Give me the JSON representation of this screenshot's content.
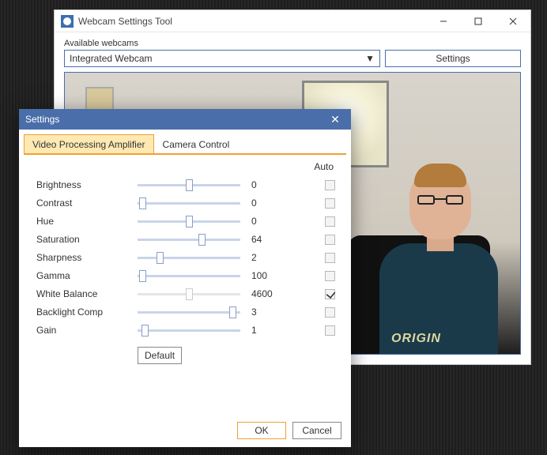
{
  "main": {
    "title": "Webcam Settings Tool",
    "group_label": "Available webcams",
    "combo_value": "Integrated Webcam",
    "settings_btn": "Settings"
  },
  "dialog": {
    "title": "Settings",
    "tabs": {
      "vpa": "Video Processing Amplifier",
      "cc": "Camera Control"
    },
    "auto_header": "Auto",
    "default_btn": "Default",
    "ok": "OK",
    "cancel": "Cancel",
    "rows": [
      {
        "label": "Brightness",
        "value": "0",
        "pos": 50,
        "auto": false,
        "enabled": true
      },
      {
        "label": "Contrast",
        "value": "0",
        "pos": 2,
        "auto": false,
        "enabled": true
      },
      {
        "label": "Hue",
        "value": "0",
        "pos": 50,
        "auto": false,
        "enabled": true
      },
      {
        "label": "Saturation",
        "value": "64",
        "pos": 64,
        "auto": false,
        "enabled": true
      },
      {
        "label": "Sharpness",
        "value": "2",
        "pos": 20,
        "auto": false,
        "enabled": true
      },
      {
        "label": "Gamma",
        "value": "100",
        "pos": 2,
        "auto": false,
        "enabled": true
      },
      {
        "label": "White Balance",
        "value": "4600",
        "pos": 50,
        "auto": true,
        "enabled": false
      },
      {
        "label": "Backlight Comp",
        "value": "3",
        "pos": 96,
        "auto": false,
        "enabled": true
      },
      {
        "label": "Gain",
        "value": "1",
        "pos": 4,
        "auto": false,
        "enabled": true
      }
    ]
  },
  "preview": {
    "shirt_text": "ORIGIN"
  }
}
